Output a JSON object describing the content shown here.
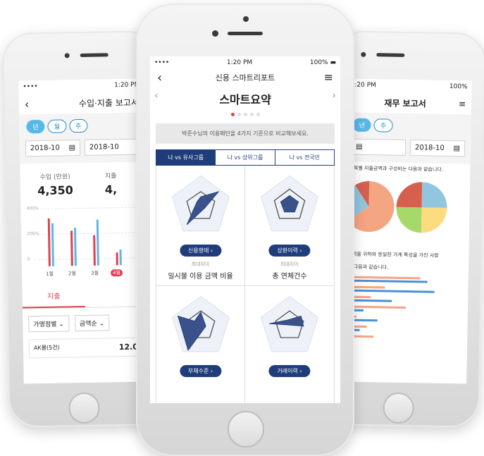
{
  "left": {
    "status": {
      "carrier": "•••• ",
      "time": "1:20 PM"
    },
    "title": "수입·지출 보고서",
    "period_tabs": [
      "년",
      "월",
      "주"
    ],
    "dates": [
      "2018-10",
      "2018-10"
    ],
    "income_label": "수입 (만원)",
    "income_value": "4,350",
    "expense_label": "지출",
    "expense_value": "4,",
    "y_ticks": [
      "400%",
      "200%",
      "0"
    ],
    "months": [
      "1월",
      "2월",
      "3월",
      "4월"
    ],
    "tab_expense": "지출",
    "filter1": "가맹점별",
    "filter2": "금액순",
    "row_label": "AK몰(5건)",
    "row_amount": "12.0"
  },
  "center": {
    "status": {
      "carrier": "••••",
      "time": "1:20 PM",
      "battery": "100%"
    },
    "nav_title": "신용 스마트리포트",
    "title": "스마트요약",
    "banner": "박준수님의 이용패턴을 4가지 기준으로 비교해보세요.",
    "segments": [
      "나 vs 유사그룹",
      "나 vs 상위그룹",
      "나 vs 전국민"
    ],
    "cards": [
      {
        "button": "신용형태",
        "sub": "최대차이",
        "main": "일시불 이용 금액 비율"
      },
      {
        "button": "상환이력",
        "sub": "최대차이",
        "main": "총 연체건수"
      },
      {
        "button": "부채수준",
        "sub": "",
        "main": ""
      },
      {
        "button": "거래이력",
        "sub": "",
        "main": ""
      }
    ]
  },
  "right": {
    "status": {
      "time": "1:20 PM",
      "battery": "100%"
    },
    "title": "재무 보고서",
    "date": "2018-10",
    "text1": "비목별 지출금액과 구성비는 다음과 같습니다.",
    "text2": "금액을 귀하와 동일한 가계 특성을 가진 사람",
    "text3": "면 다음과 같습니다."
  },
  "colors": {
    "accent_red": "#e0404f",
    "navy": "#1f3d7a",
    "sky": "#5ab8e8"
  },
  "chart_data": {
    "type": "bar",
    "categories": [
      "1월",
      "2월",
      "3월",
      "4월"
    ],
    "series": [
      {
        "values": [
          190,
          140,
          120,
          50
        ]
      },
      {
        "values": [
          170,
          150,
          180,
          60
        ]
      }
    ]
  }
}
